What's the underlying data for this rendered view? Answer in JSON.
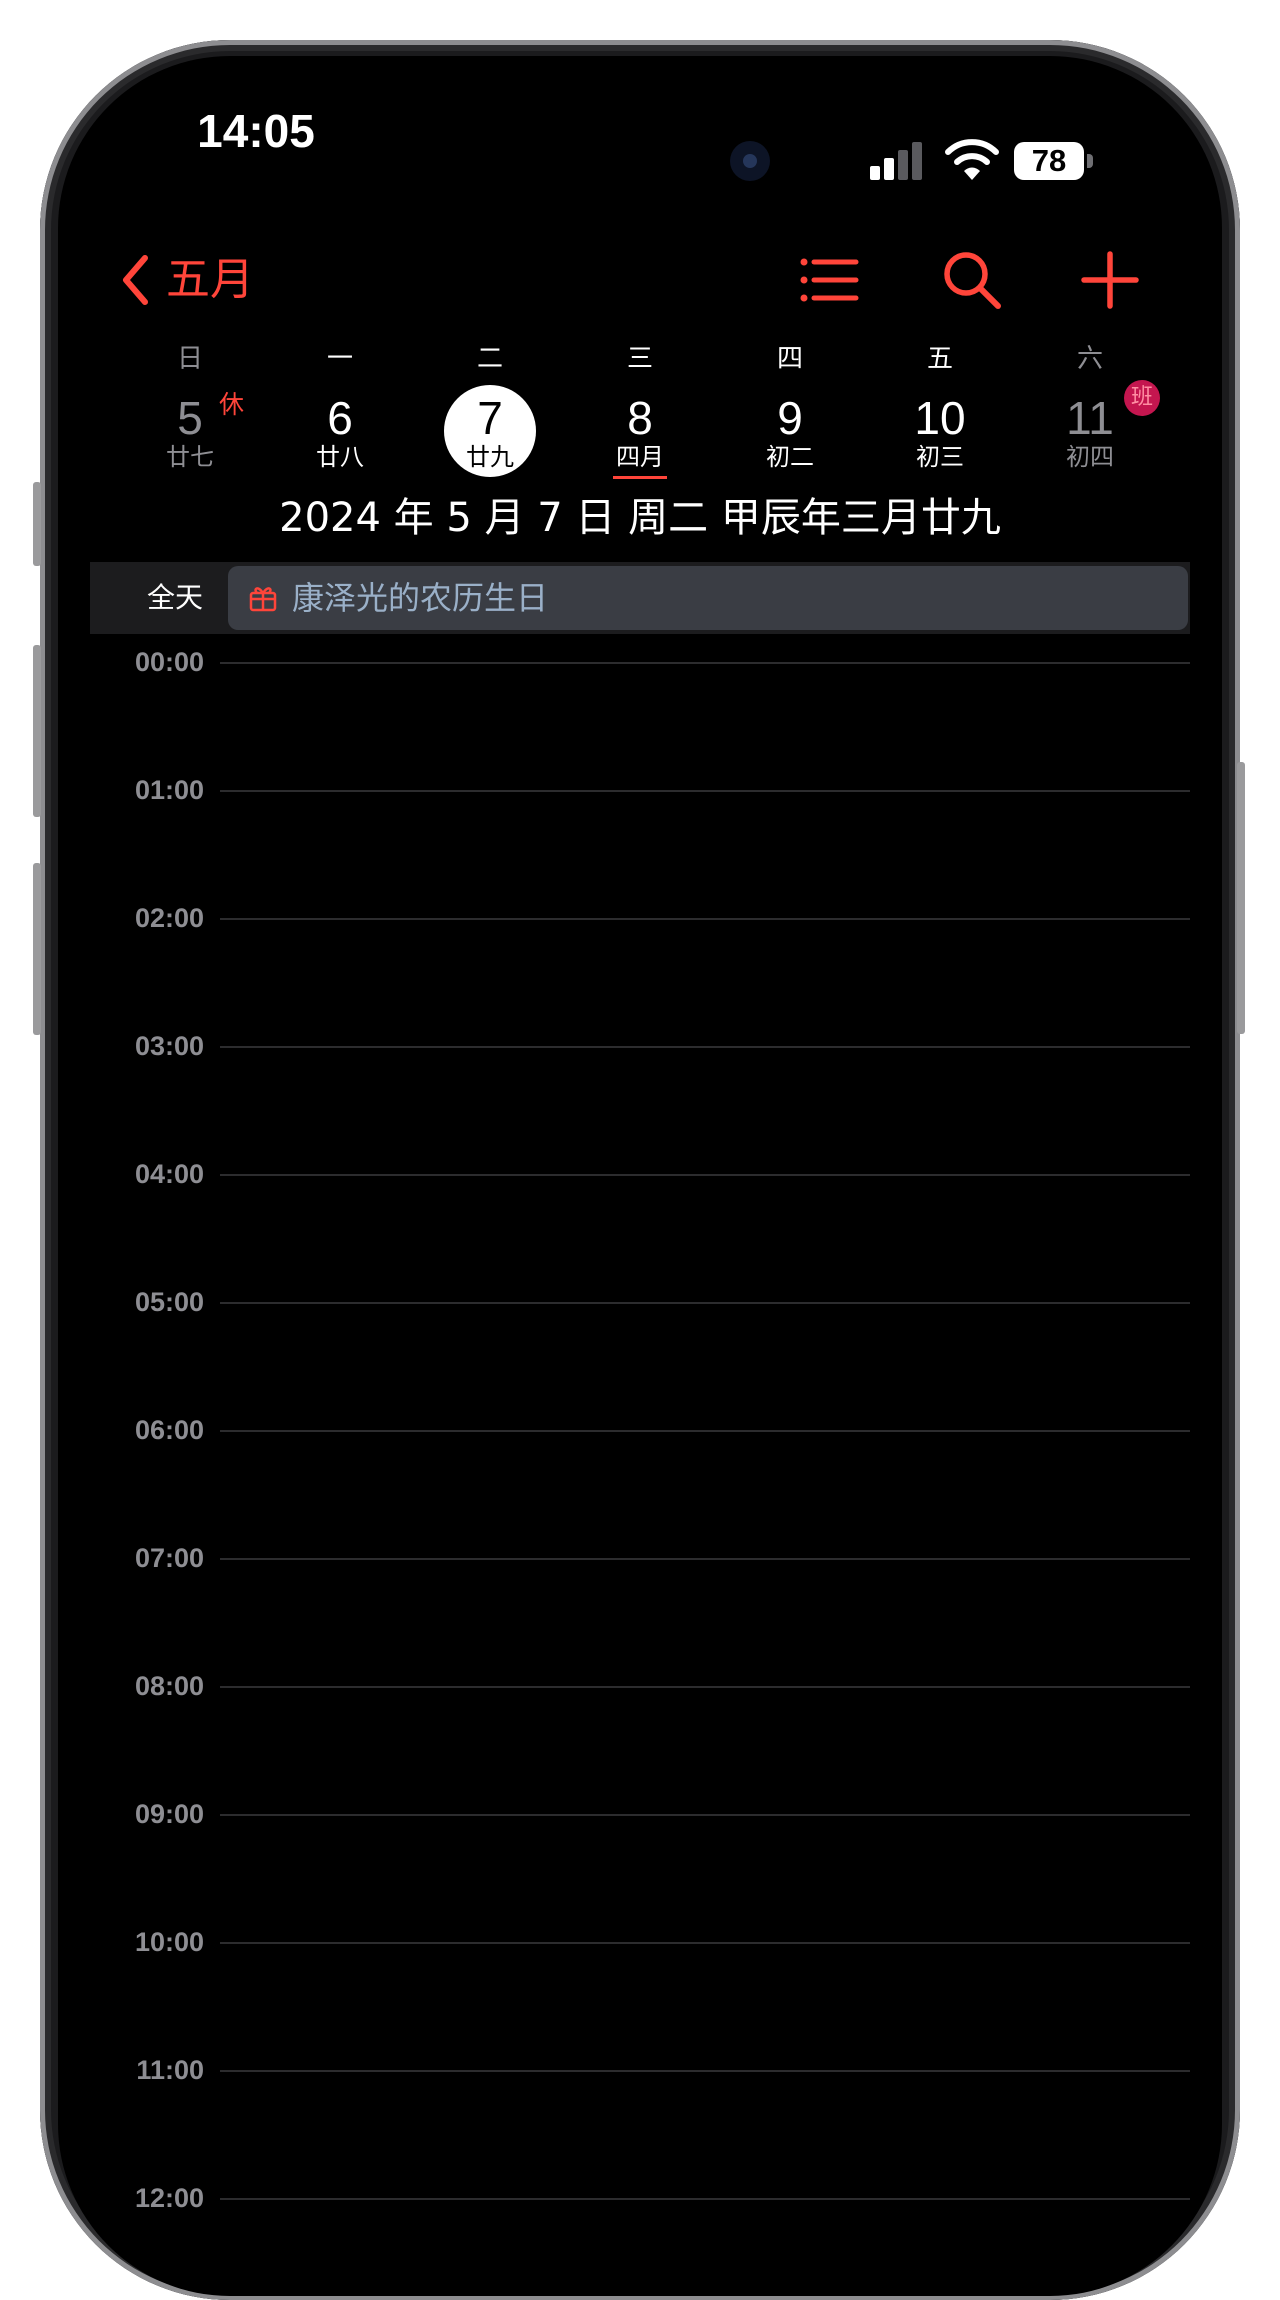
{
  "status_bar": {
    "time": "14:05",
    "battery": "78"
  },
  "nav": {
    "back_label": "五月"
  },
  "week": [
    {
      "weekday": "日",
      "day": "5",
      "lunar": "廿七",
      "weekend": true,
      "tag": "休"
    },
    {
      "weekday": "一",
      "day": "6",
      "lunar": "廿八",
      "weekend": false
    },
    {
      "weekday": "二",
      "day": "7",
      "lunar": "廿九",
      "weekend": false,
      "selected": true
    },
    {
      "weekday": "三",
      "day": "8",
      "lunar": "四月",
      "weekend": false
    },
    {
      "weekday": "四",
      "day": "9",
      "lunar": "初二",
      "weekend": false
    },
    {
      "weekday": "五",
      "day": "10",
      "lunar": "初三",
      "weekend": false
    },
    {
      "weekday": "六",
      "day": "11",
      "lunar": "初四",
      "weekend": true,
      "badge": "班"
    }
  ],
  "date_title": "2024 年 5 月 7 日  周二   甲辰年三月廿九",
  "all_day": {
    "label": "全天",
    "event": {
      "title": "康泽光的农历生日",
      "icon": "gift-icon"
    }
  },
  "hours": [
    "00:00",
    "01:00",
    "02:00",
    "03:00",
    "04:00",
    "05:00",
    "06:00",
    "07:00",
    "08:00",
    "09:00",
    "10:00",
    "11:00",
    "12:00"
  ],
  "colors": {
    "accent": "#ff453a",
    "background": "#000000",
    "muted": "#8e8e93",
    "event_bg": "#3a3d44",
    "badge": "#c4164f"
  }
}
